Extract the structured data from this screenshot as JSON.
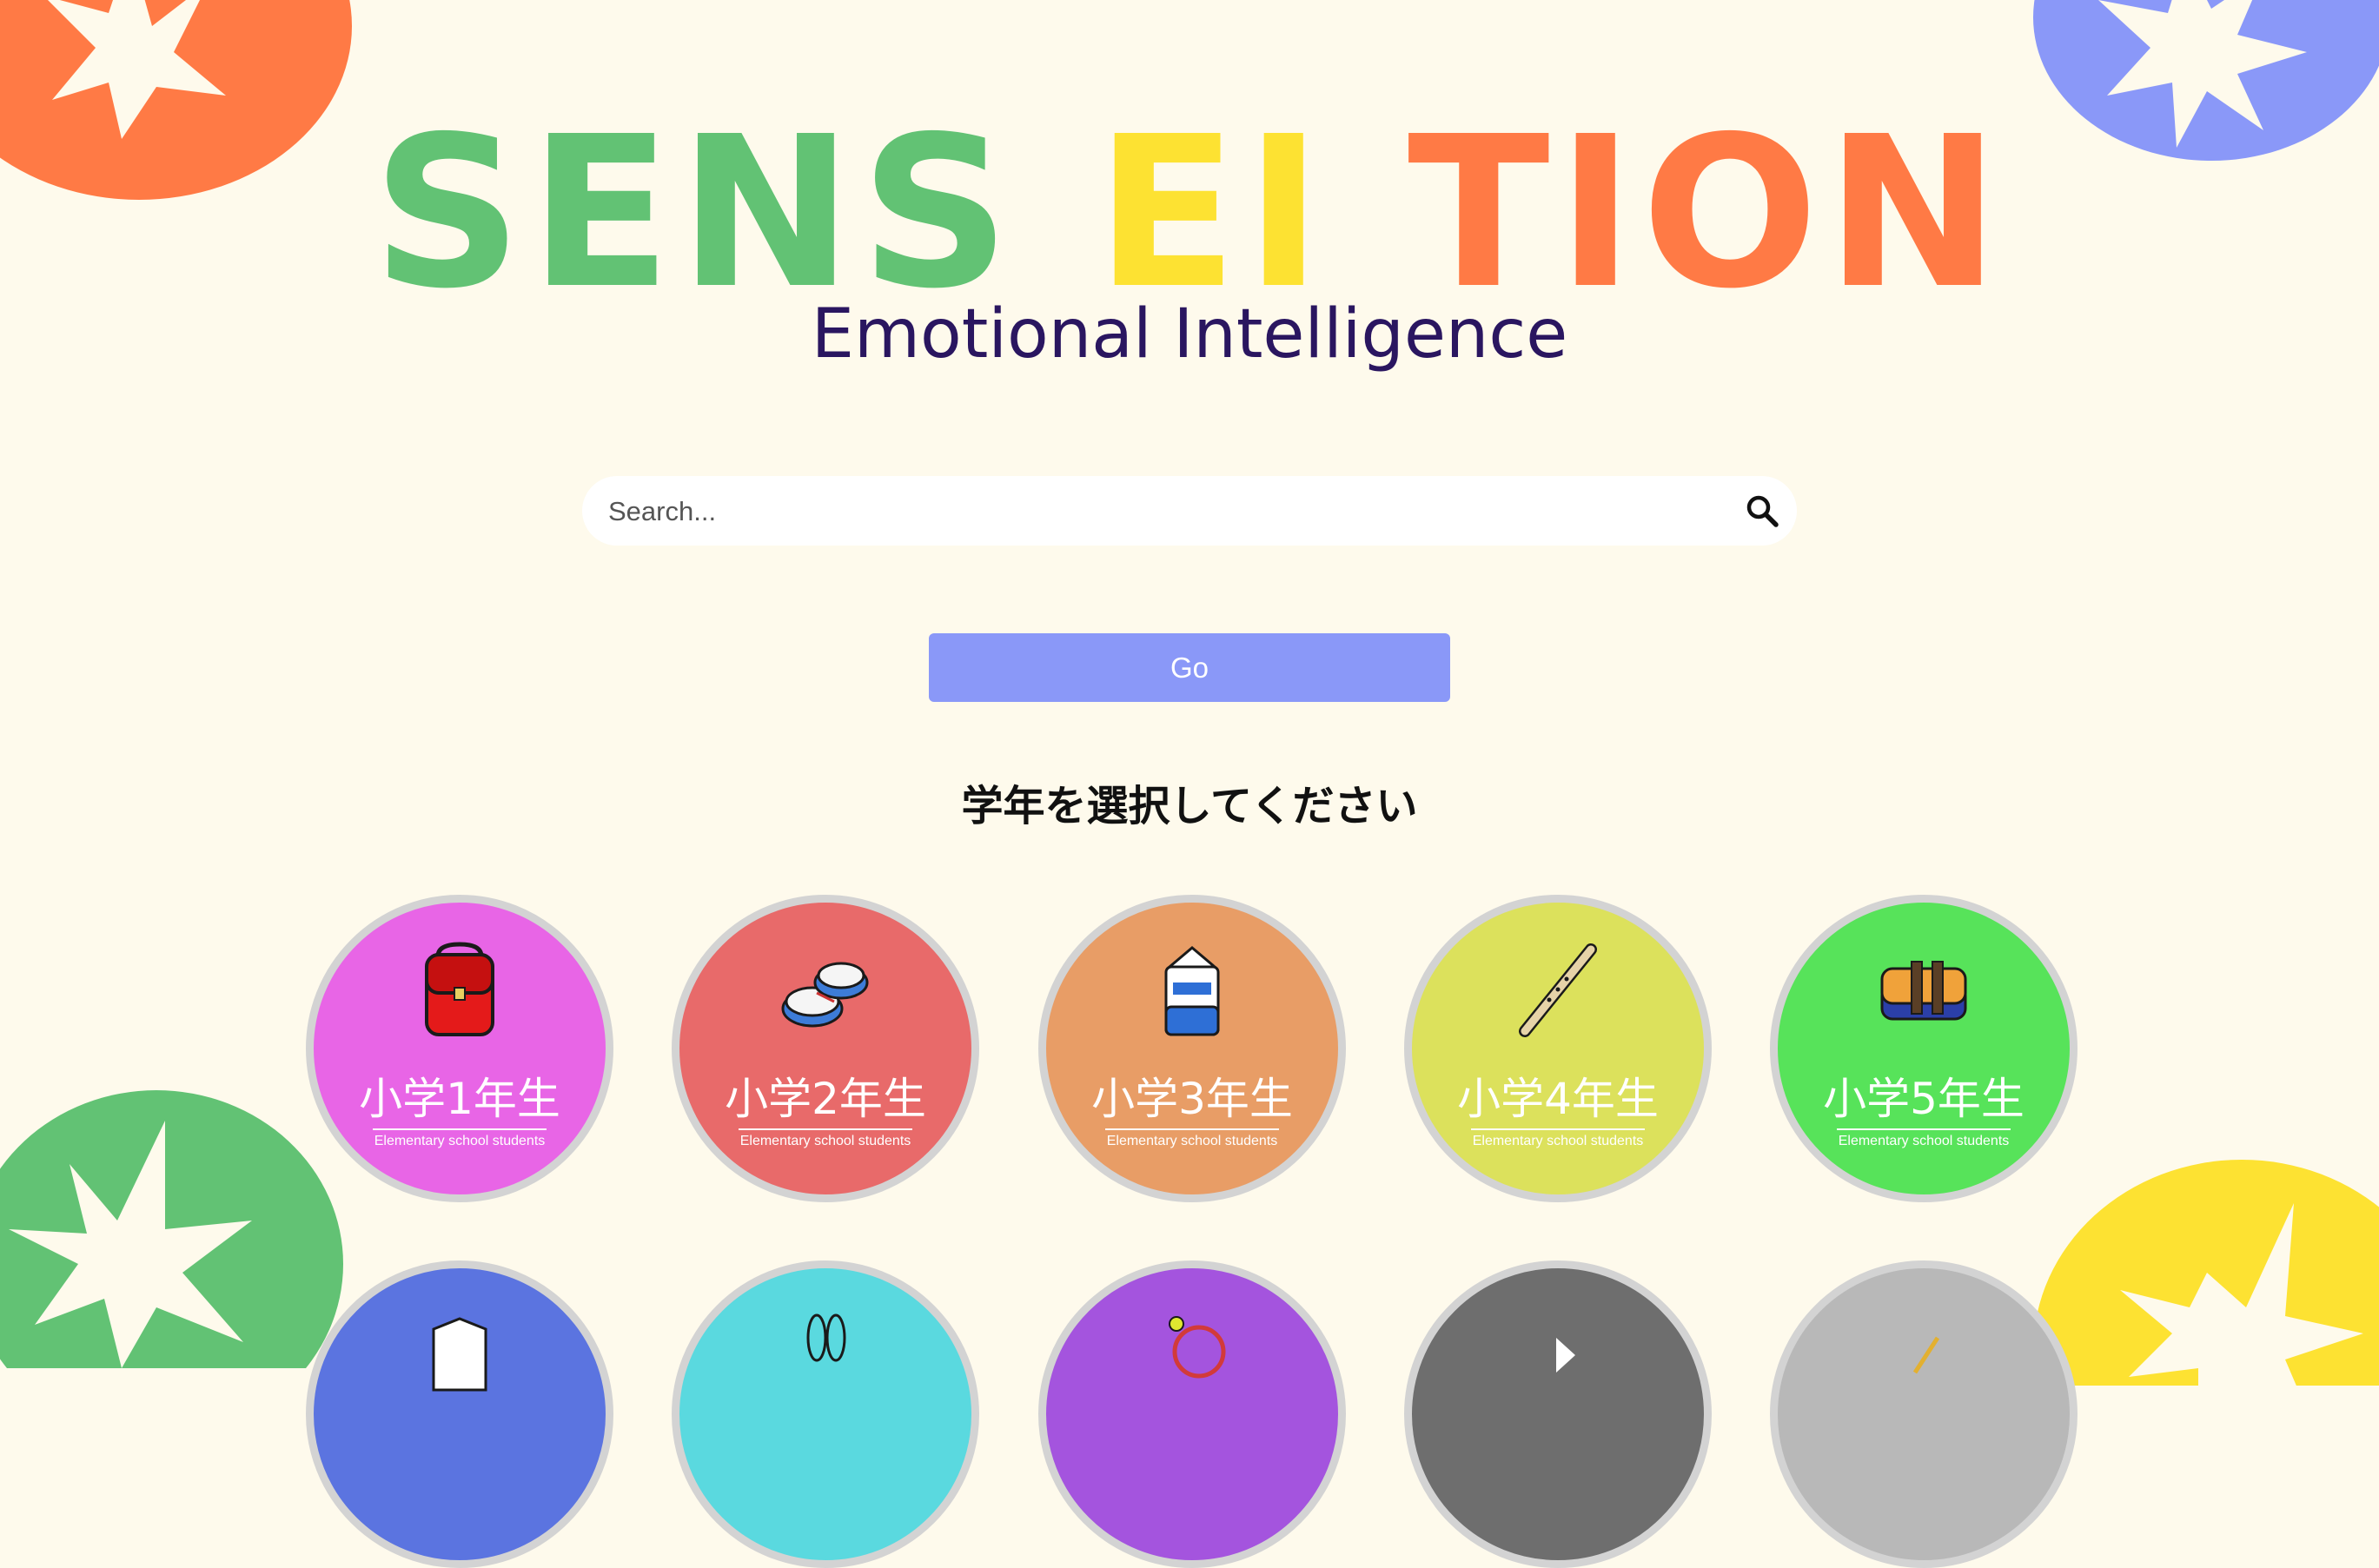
{
  "brand": {
    "logo_parts": [
      {
        "text": "SENS",
        "color": "#62c274"
      },
      {
        "text": "EI",
        "color": "#fde232"
      },
      {
        "text": "TION",
        "color": "#ff7a45"
      }
    ],
    "subtitle": "Emotional Intelligence"
  },
  "search": {
    "placeholder": "Search...",
    "icon": "search-icon"
  },
  "go_button": {
    "label": "Go",
    "color": "#8a98f8"
  },
  "grade_prompt": "学年を選択してください",
  "grades": [
    {
      "label": "小学1年生",
      "sublabel": "Elementary school students",
      "color": "#e865e6",
      "icon": "school-backpack-icon"
    },
    {
      "label": "小学2年生",
      "sublabel": "Elementary school students",
      "color": "#e86a6a",
      "icon": "indoor-shoes-icon"
    },
    {
      "label": "小学3年生",
      "sublabel": "Elementary school students",
      "color": "#e89d66",
      "icon": "milk-carton-icon"
    },
    {
      "label": "小学4年生",
      "sublabel": "Elementary school students",
      "color": "#dce15c",
      "icon": "recorder-flute-icon"
    },
    {
      "label": "小学5年生",
      "sublabel": "Elementary school students",
      "color": "#57e35a",
      "icon": "lunch-box-icon"
    }
  ],
  "partial_grades": [
    {
      "color": "#5b74e0",
      "icon": "partial-icon"
    },
    {
      "color": "#5ad9df",
      "icon": "partial-icon"
    },
    {
      "color": "#a454de",
      "icon": "racket-icon"
    },
    {
      "color": "#6e6e6e",
      "icon": "partial-icon"
    },
    {
      "color": "#b8b8b8",
      "icon": "partial-icon"
    }
  ],
  "decor_colors": [
    "#ff7a45",
    "#8a98f8",
    "#62c274",
    "#fde232"
  ]
}
